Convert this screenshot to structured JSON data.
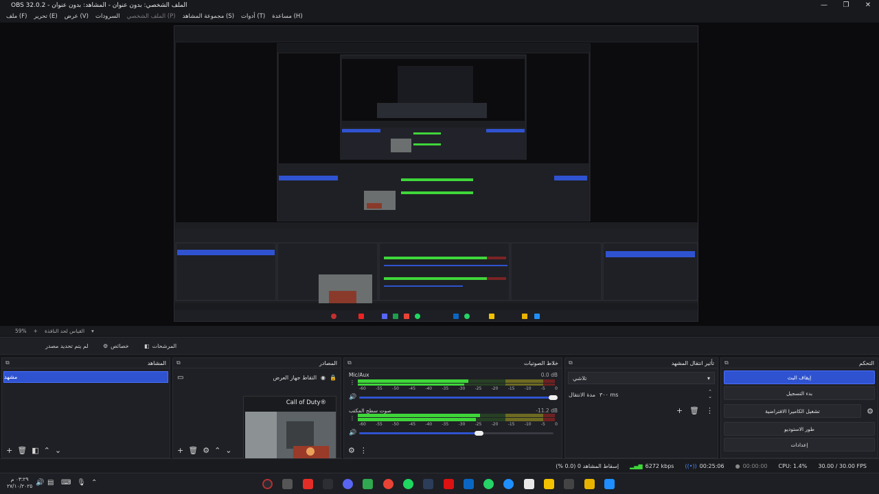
{
  "window": {
    "title": "OBS 32.0.2 - الملف الشخصي: بدون عنوان - المشاهد: بدون عنوان",
    "minimize": "—",
    "maximize": "❐",
    "close": "✕"
  },
  "menu": {
    "items": [
      {
        "label": "(F) ملف",
        "dim": false
      },
      {
        "label": "(E) تحرير",
        "dim": false
      },
      {
        "label": "(V) عرض",
        "dim": false
      },
      {
        "label": "السرودات",
        "dim": false
      },
      {
        "label": "(P) الملف الشخصي",
        "dim": true
      },
      {
        "label": "(S) مجموعة المشاهد",
        "dim": false
      },
      {
        "label": "(T) أدوات",
        "dim": false
      },
      {
        "label": "(H) مساعدة",
        "dim": false
      }
    ]
  },
  "zoombar": {
    "zoom": "59%",
    "plus": "+",
    "label": "القياس لحد النافذة"
  },
  "source_toolbar": {
    "no_source": "لم يتم تحديد مصدر",
    "properties": "خصائص",
    "filters": "المرشحات"
  },
  "scenes": {
    "title": "المشاهد",
    "items": [
      "مشهد"
    ]
  },
  "sources": {
    "title": "المصادر",
    "items": [
      {
        "name": "التقاط جهاز العرض",
        "visible_icon": "eye-icon",
        "lock_icon": "lock-icon"
      }
    ],
    "tooltip_text": "Call of Duty®"
  },
  "mixer": {
    "title": "خلاط الصوتيات",
    "channels": [
      {
        "name": "Mic/Aux",
        "db": "0.0 dB",
        "level": 0.56,
        "volume": 1.0
      },
      {
        "name": "صوت سطح المكتب",
        "db": "-11.2 dB",
        "level": 0.62,
        "volume": 0.62
      }
    ],
    "ticks": [
      "-60",
      "-55",
      "-50",
      "-45",
      "-40",
      "-35",
      "-30",
      "-25",
      "-20",
      "-15",
      "-10",
      "-5",
      "0"
    ]
  },
  "transitions": {
    "title": "تأثير انتقال المشهد",
    "selected": "تلاشي",
    "duration_label": "مدة الانتقال",
    "duration_value": "٣٠٠ ms"
  },
  "controls": {
    "title": "التحكم",
    "buttons": [
      {
        "label": "إيقاف البث",
        "primary": true
      },
      {
        "label": "بدء التسجيل",
        "primary": false
      },
      {
        "label": "تشغيل الكاميرا الافتراضية",
        "primary": false
      },
      {
        "label": "طور الاستوديو",
        "primary": false
      },
      {
        "label": "إعدادات",
        "primary": false
      }
    ]
  },
  "status": {
    "dropped": "إسقاط المشاهد 0 (0.0 %)",
    "bitrate": "6272 kbps",
    "stream_time": "00:25:06",
    "rec_time": "00:00:00",
    "cpu": "CPU: 1.4%",
    "fps": "30.00 / 30.00 FPS"
  },
  "taskbar": {
    "clock_time": "٠٣:٢٩ م",
    "clock_date": "٢٧/١٠/٢٠٢٥"
  },
  "colors": {
    "accent": "#2f53d0",
    "meter_green": "#3fd63a",
    "meter_yellow": "#8c8a23",
    "meter_red": "#7a2424"
  }
}
